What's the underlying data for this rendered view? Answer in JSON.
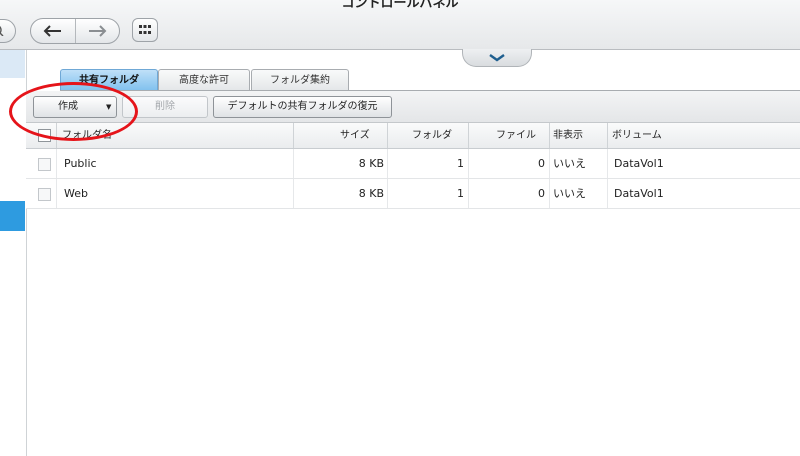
{
  "window": {
    "title": "コントロールパネル"
  },
  "toolbar": {
    "search_icon": "search-icon",
    "back_icon": "arrow-left-icon",
    "forward_icon": "arrow-right-icon",
    "apps_icon": "grid-icon"
  },
  "tabs": [
    {
      "label": "共有フォルダ",
      "active": true
    },
    {
      "label": "高度な許可",
      "active": false
    },
    {
      "label": "フォルダ集約",
      "active": false
    }
  ],
  "actions": {
    "create": "作成",
    "delete": "削除",
    "restore": "デフォルトの共有フォルダの復元"
  },
  "table": {
    "headers": {
      "name": "フォルダ名",
      "size": "サイズ",
      "folders": "フォルダ",
      "files": "ファイル",
      "hidden": "非表示",
      "volume": "ボリューム"
    },
    "rows": [
      {
        "name": "Public",
        "size": "8 KB",
        "folders": "1",
        "files": "0",
        "hidden": "いいえ",
        "volume": "DataVol1"
      },
      {
        "name": "Web",
        "size": "8 KB",
        "folders": "1",
        "files": "0",
        "hidden": "いいえ",
        "volume": "DataVol1"
      }
    ]
  },
  "colors": {
    "accent": "#2e9be0",
    "active_tab": "#7fc0ee",
    "annotation": "#e5141a"
  }
}
